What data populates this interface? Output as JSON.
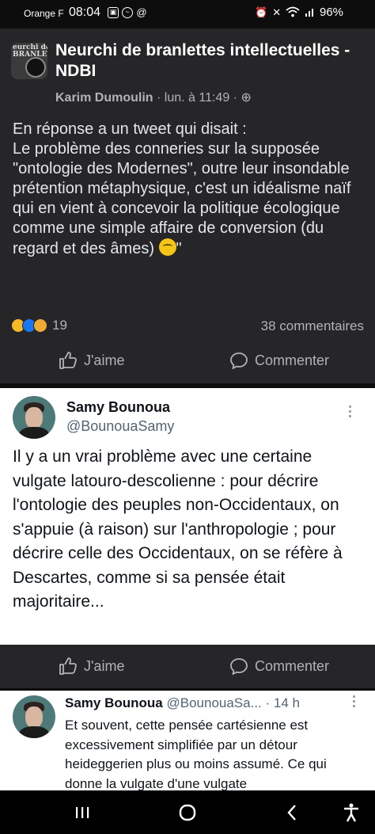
{
  "status_bar": {
    "carrier": "Orange F",
    "time": "08:04",
    "battery": "96%",
    "left_icons": [
      "gallery-icon",
      "messenger-icon",
      "threads-icon"
    ],
    "right_icons": [
      "alarm-icon",
      "mute-icon",
      "wifi-icon",
      "signal-icon"
    ]
  },
  "post": {
    "group_name": "Neurchi de branlettes intellectuelles - NDBI",
    "group_avatar_text": "eurchi de\nBRANLETTES",
    "author": "Karim Dumoulin",
    "meta": " · lun. à 11:49 · ",
    "privacy_icon": "globe-icon",
    "body": "En réponse a un tweet qui disait :\nLe problème des conneries sur la supposée \"ontologie des Modernes\", outre leur insondable prétention métaphysique, c'est un idéalisme naïf qui en vient à concevoir la politique écologique comme une simple affaire de conversion (du regard et des âmes) ",
    "body_end": "\"",
    "reactions": [
      "haha",
      "like",
      "care"
    ],
    "reaction_count": "19",
    "comments_count": "38 commentaires",
    "like_label": "J'aime",
    "comment_label": "Commenter"
  },
  "tweet1": {
    "name": "Samy Bounoua",
    "handle": "@BounouaSamy",
    "text": "Il y a un vrai problème avec une certaine vulgate latouro-descolienne : pour décrire l'ontologie des peuples non-Occidentaux, on s'appuie (à raison) sur l'anthropologie ; pour décrire celle des Occidentaux, on se réfère à Descartes, comme si sa pensée était majoritaire..."
  },
  "actions2": {
    "like_label": "J'aime",
    "comment_label": "Commenter"
  },
  "tweet2": {
    "name": "Samy Bounoua",
    "handle": "@BounouaSa...",
    "time": " · 14 h",
    "text": "Et souvent, cette pensée cartésienne est excessivement simplifiée par un détour heideggerien plus ou moins assumé. Ce qui donne la vulgate d'une vulgate"
  },
  "nav": [
    "recents-button",
    "home-button",
    "back-button",
    "accessibility-button"
  ],
  "colors": {
    "card_bg": "#262628",
    "tweet_bg": "#ffffff",
    "muted_text": "#b0b3b8"
  }
}
